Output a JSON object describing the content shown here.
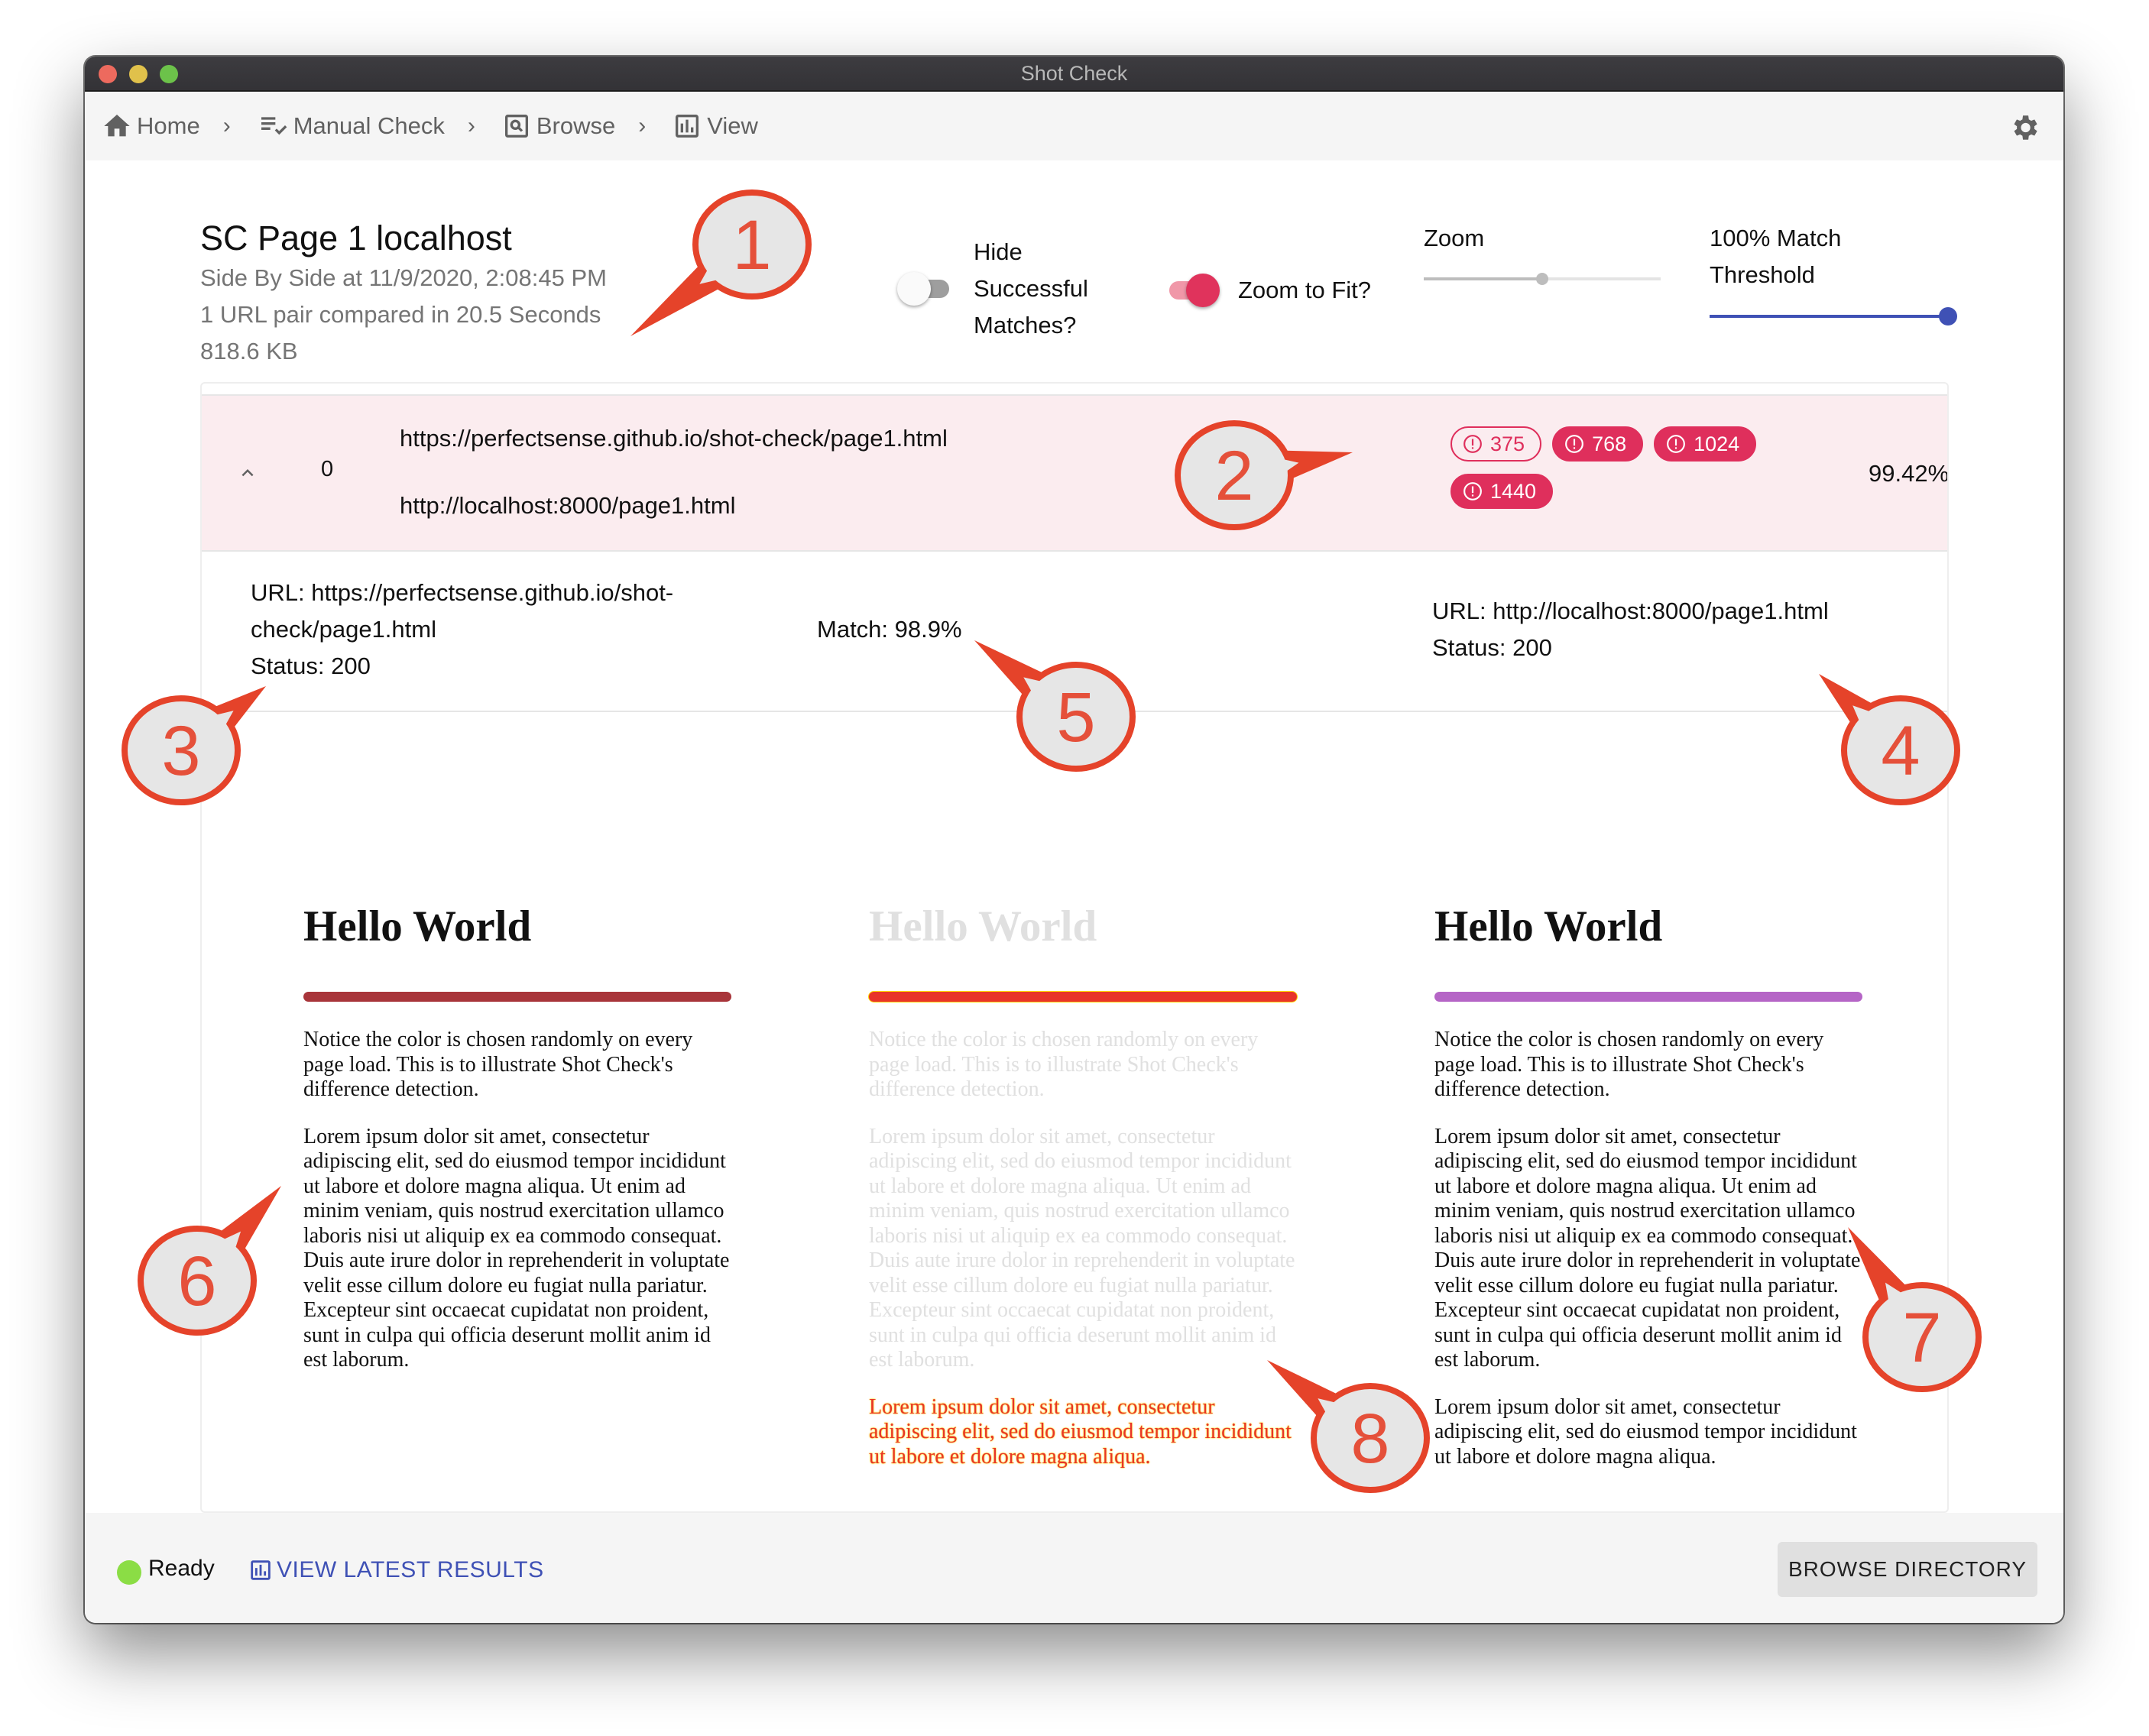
{
  "window": {
    "title": "Shot Check"
  },
  "breadcrumb": [
    {
      "label": "Home",
      "icon": "home-icon"
    },
    {
      "label": "Manual Check",
      "icon": "checklist-icon"
    },
    {
      "label": "Browse",
      "icon": "search-box-icon"
    },
    {
      "label": "View",
      "icon": "bar-chart-icon"
    }
  ],
  "breadcrumb_separator": "›",
  "header": {
    "title": "SC Page 1 localhost",
    "subtitle": "Side By Side at 11/9/2020, 2:08:45 PM",
    "summary": "1 URL pair compared in 20.5 Seconds",
    "size": "818.6 KB"
  },
  "controls": {
    "hide_successful": {
      "label_lines": [
        "Hide",
        "Successful",
        "Matches?"
      ],
      "checked": false
    },
    "zoom_to_fit": {
      "label": "Zoom to Fit?",
      "checked": true
    },
    "zoom": {
      "label": "Zoom",
      "value_fraction": 0.5
    },
    "threshold": {
      "label_lines": [
        "100% Match",
        "Threshold"
      ],
      "value_fraction": 1.0
    }
  },
  "result": {
    "index": "0",
    "url_a": "https://perfectsense.github.io/shot-check/page1.html",
    "url_b": "http://localhost:8000/page1.html",
    "breakpoints": [
      {
        "label": "375",
        "selected": true
      },
      {
        "label": "768",
        "selected": false
      },
      {
        "label": "1024",
        "selected": false
      },
      {
        "label": "1440",
        "selected": false
      }
    ],
    "match_percent": "99.42%"
  },
  "detail": {
    "left": {
      "url_line1": "URL: https://perfectsense.github.io/shot-",
      "url_line2": "check/page1.html",
      "status": "Status: 200"
    },
    "center": {
      "match": "Match: 98.9%"
    },
    "right": {
      "url": "URL: http://localhost:8000/page1.html",
      "status": "Status: 200"
    }
  },
  "screenshots": {
    "heading": "Hello World",
    "notice": "Notice the color is chosen randomly on every page load. This is to illustrate Shot Check's difference detection.",
    "lorem": "Lorem ipsum dolor sit amet, consectetur adipiscing elit, sed do eiusmod tempor incididunt ut labore et dolore magna aliqua. Ut enim ad minim veniam, quis nostrud exercitation ullamco laboris nisi ut aliquip ex ea commodo consequat. Duis aute irure dolor in reprehenderit in voluptate velit esse cillum dolore eu fugiat nulla pariatur. Excepteur sint occaecat cupidatat non proident, sunt in culpa qui officia deserunt mollit anim id est laborum.",
    "lorem_short": "Lorem ipsum dolor sit amet, consectetur adipiscing elit, sed do eiusmod tempor incididunt ut labore et dolore magna aliqua.",
    "colors": {
      "left_rule": "#a8353a",
      "diff_rule": "#e8342a",
      "right_rule": "#b565c6"
    }
  },
  "footer": {
    "status": "Ready",
    "status_color": "#8bdd45",
    "view_latest": "VIEW LATEST RESULTS",
    "browse_directory": "BROWSE DIRECTORY"
  },
  "annotations": [
    "1",
    "2",
    "3",
    "4",
    "5",
    "6",
    "7",
    "8"
  ],
  "colors": {
    "accent": "#df2f5c",
    "primary": "#3f51b5",
    "callout": "#e5432a"
  }
}
